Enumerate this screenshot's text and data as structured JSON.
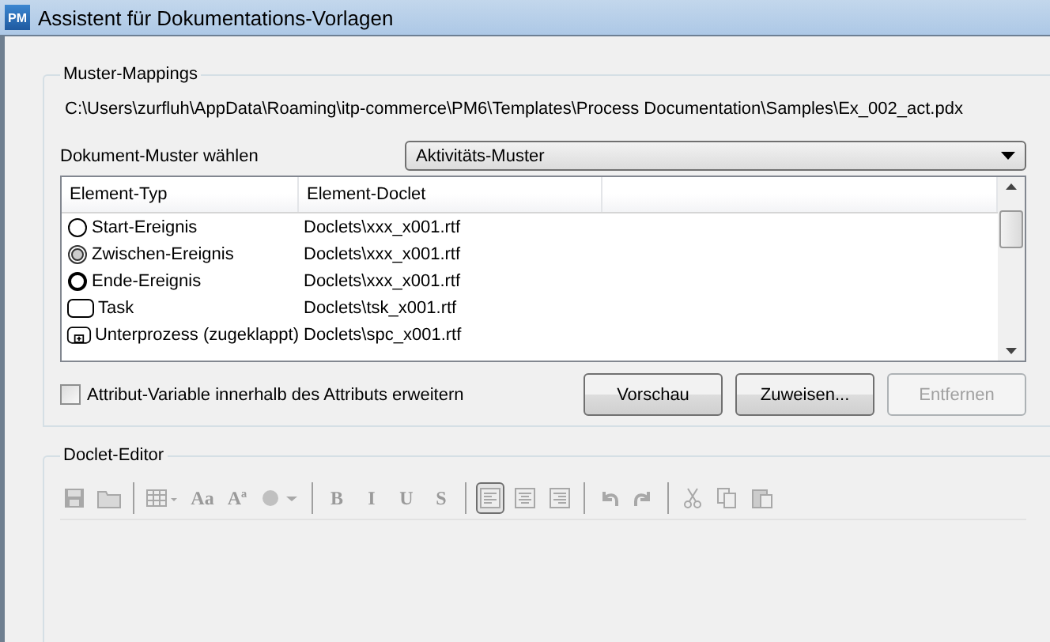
{
  "window": {
    "title": "Assistent für Dokumentations-Vorlagen",
    "app_icon": "PM"
  },
  "mappings": {
    "title": "Muster-Mappings",
    "path": "C:\\Users\\zurfluh\\AppData\\Roaming\\itp-commerce\\PM6\\Templates\\Process  Documentation\\Samples\\Ex_002_act.pdx",
    "pattern_label": "Dokument-Muster wählen",
    "pattern_value": "Aktivitäts-Muster",
    "columns": [
      "Element-Typ",
      "Element-Doclet"
    ],
    "rows": [
      {
        "kind": "start",
        "type": "Start-Ereignis",
        "doclet": "Doclets\\xxx_x001.rtf"
      },
      {
        "kind": "intermediate",
        "type": "Zwischen-Ereignis",
        "doclet": "Doclets\\xxx_x001.rtf"
      },
      {
        "kind": "end",
        "type": "Ende-Ereignis",
        "doclet": "Doclets\\xxx_x001.rtf"
      },
      {
        "kind": "task",
        "type": "Task",
        "doclet": "Doclets\\tsk_x001.rtf"
      },
      {
        "kind": "subprocess",
        "type": "Unterprozess (zugeklappt)",
        "doclet": "Doclets\\spc_x001.rtf"
      }
    ],
    "checkbox": {
      "label": "Attribut-Variable innerhalb des Attributs erweitern",
      "checked": false
    },
    "buttons": [
      {
        "label": "Vorschau",
        "disabled": false
      },
      {
        "label": "Zuweisen...",
        "disabled": false
      },
      {
        "label": "Entfernen",
        "disabled": true
      }
    ]
  },
  "editor": {
    "title": "Doclet-Editor",
    "toolbar": [
      {
        "kind": "save"
      },
      {
        "kind": "folder"
      },
      {
        "kind": "separator"
      },
      {
        "kind": "table"
      },
      {
        "kind": "text",
        "label": "Aa"
      },
      {
        "kind": "text",
        "label": "Aª"
      },
      {
        "kind": "color"
      },
      {
        "kind": "separator"
      },
      {
        "kind": "text",
        "label": "B",
        "selected": false
      },
      {
        "kind": "text",
        "label": "I",
        "selected": false
      },
      {
        "kind": "text",
        "label": "U",
        "selected": false
      },
      {
        "kind": "text",
        "label": "S",
        "selected": false
      },
      {
        "kind": "separator"
      },
      {
        "kind": "align-left",
        "selected": true
      },
      {
        "kind": "align-center",
        "selected": false
      },
      {
        "kind": "align-right",
        "selected": false
      },
      {
        "kind": "separator"
      },
      {
        "kind": "undo"
      },
      {
        "kind": "redo"
      },
      {
        "kind": "separator"
      },
      {
        "kind": "cut"
      },
      {
        "kind": "copy"
      },
      {
        "kind": "paste"
      }
    ]
  }
}
